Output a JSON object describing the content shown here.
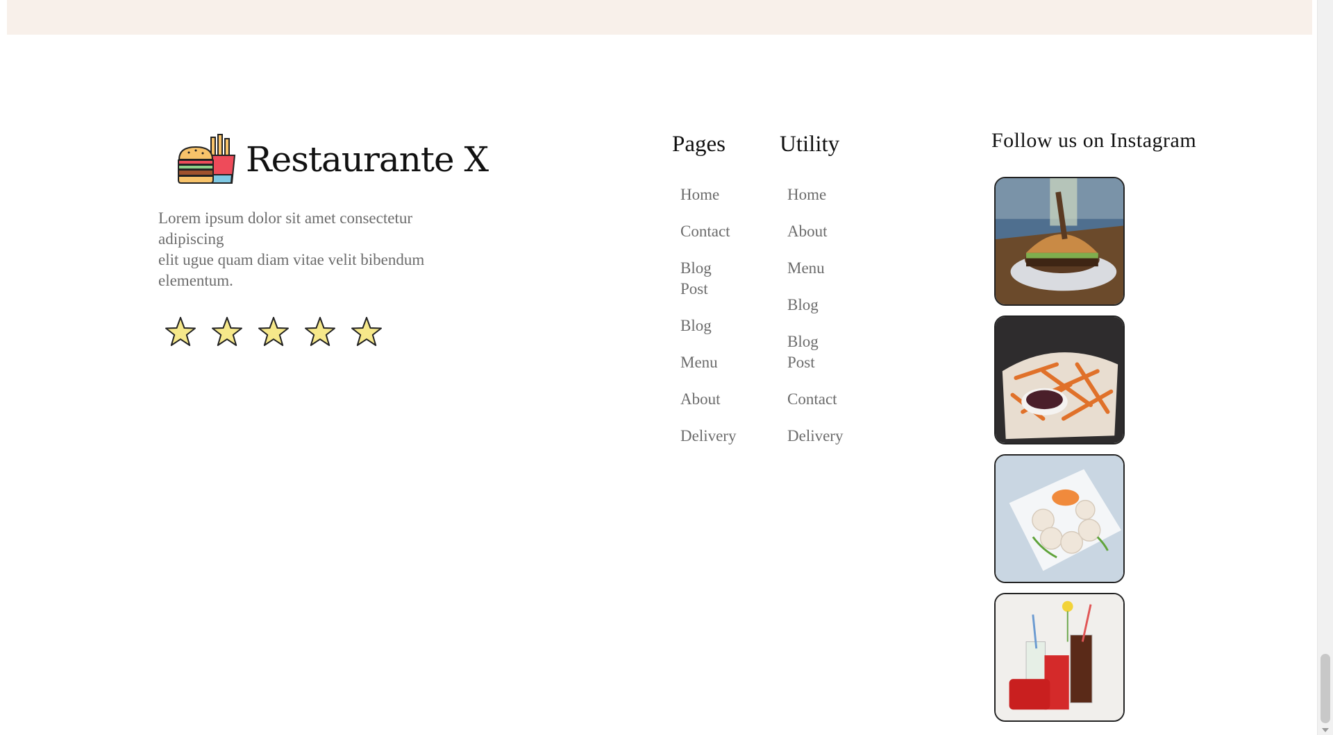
{
  "brand": {
    "name": "Restaurante X",
    "icon": "burger-fries-icon"
  },
  "description": {
    "line1": "Lorem ipsum dolor sit amet consectetur adipiscing",
    "line2": "elit ugue quam diam vitae velit bibendum elementum."
  },
  "rating": {
    "stars": 5,
    "icon": "star-icon"
  },
  "pages": {
    "heading": "Pages",
    "links": [
      "Home",
      "Contact",
      "Blog Post",
      "Blog",
      "Menu",
      "About",
      "Delivery"
    ]
  },
  "utility": {
    "heading": "Utility",
    "links": [
      "Home",
      "About",
      "Menu",
      "Blog",
      "Blog Post",
      "Contact",
      "Delivery"
    ]
  },
  "instagram": {
    "heading": "Follow us on Instagram",
    "images": [
      "burger",
      "sweet-potato-fries",
      "dumplings",
      "cola-drinks"
    ]
  },
  "colors": {
    "top_band": "#f8f0ea",
    "body_text": "#6b6b6b",
    "heading_text": "#111111",
    "star_fill": "#f6e88a"
  }
}
